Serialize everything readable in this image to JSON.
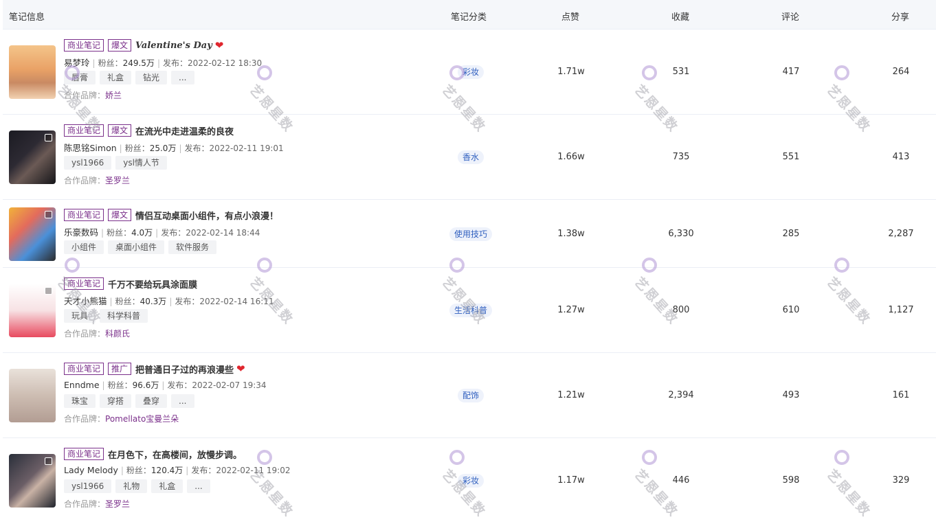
{
  "header": {
    "info": "笔记信息",
    "category": "笔记分类",
    "likes": "点赞",
    "collects": "收藏",
    "comments": "评论",
    "shares": "分享"
  },
  "watermark": "艺恩星数",
  "rows": [
    {
      "badges": [
        "商业笔记",
        "爆文"
      ],
      "title": "Valentine's Day",
      "heart": true,
      "author": "易梦玲",
      "fans_label": "粉丝：",
      "fans": "249.5万",
      "pub_label": "发布：",
      "pub": "2022-02-12 18:30",
      "tags": [
        "唇膏",
        "礼盒",
        "钻光",
        "..."
      ],
      "brand_label": "合作品牌：",
      "brand": "娇兰",
      "category": "彩妆",
      "likes": "1.71w",
      "collects": "531",
      "comments": "417",
      "shares": "264",
      "video": false
    },
    {
      "badges": [
        "商业笔记",
        "爆文"
      ],
      "title": "在流光中走进温柔的良夜",
      "heart": false,
      "author": "陈思铭Simon",
      "fans_label": "粉丝：",
      "fans": "25.0万",
      "pub_label": "发布：",
      "pub": "2022-02-11 19:01",
      "tags": [
        "ysl1966",
        "ysl情人节"
      ],
      "brand_label": "合作品牌：",
      "brand": "圣罗兰",
      "category": "香水",
      "likes": "1.66w",
      "collects": "735",
      "comments": "551",
      "shares": "413",
      "video": true
    },
    {
      "badges": [
        "商业笔记",
        "爆文"
      ],
      "title": "情侣互动桌面小组件，有点小浪漫！",
      "heart": false,
      "author": "乐豪数码",
      "fans_label": "粉丝：",
      "fans": "4.0万",
      "pub_label": "发布：",
      "pub": "2022-02-14 18:44",
      "tags": [
        "小组件",
        "桌面小组件",
        "软件服务"
      ],
      "brand_label": "",
      "brand": "",
      "category": "使用技巧",
      "likes": "1.38w",
      "collects": "6,330",
      "comments": "285",
      "shares": "2,287",
      "video": true
    },
    {
      "badges": [
        "商业笔记"
      ],
      "title": "千万不要给玩具涂面膜",
      "heart": false,
      "author": "天才小熊猫",
      "fans_label": "粉丝：",
      "fans": "40.3万",
      "pub_label": "发布：",
      "pub": "2022-02-14 16:11",
      "tags": [
        "玩具",
        "科学科普"
      ],
      "brand_label": "合作品牌：",
      "brand": "科颜氏",
      "category": "生活科普",
      "likes": "1.27w",
      "collects": "800",
      "comments": "610",
      "shares": "1,127",
      "video": true
    },
    {
      "badges": [
        "商业笔记",
        "推广"
      ],
      "title": "把普通日子过的再浪漫些",
      "heart": true,
      "author": "Enndme",
      "fans_label": "粉丝：",
      "fans": "96.6万",
      "pub_label": "发布：",
      "pub": "2022-02-07 19:34",
      "tags": [
        "珠宝",
        "穿搭",
        "叠穿",
        "..."
      ],
      "brand_label": "合作品牌：",
      "brand": "Pomellato宝曼兰朵",
      "category": "配饰",
      "likes": "1.21w",
      "collects": "2,394",
      "comments": "493",
      "shares": "161",
      "video": false
    },
    {
      "badges": [
        "商业笔记"
      ],
      "title": "在月色下，在高楼间，放慢步调。",
      "heart": false,
      "author": "Lady Melody",
      "fans_label": "粉丝：",
      "fans": "120.4万",
      "pub_label": "发布：",
      "pub": "2022-02-11 19:02",
      "tags": [
        "ysl1966",
        "礼物",
        "礼盒",
        "..."
      ],
      "brand_label": "合作品牌：",
      "brand": "圣罗兰",
      "category": "彩妆",
      "likes": "1.17w",
      "collects": "446",
      "comments": "598",
      "shares": "329",
      "video": true
    }
  ]
}
